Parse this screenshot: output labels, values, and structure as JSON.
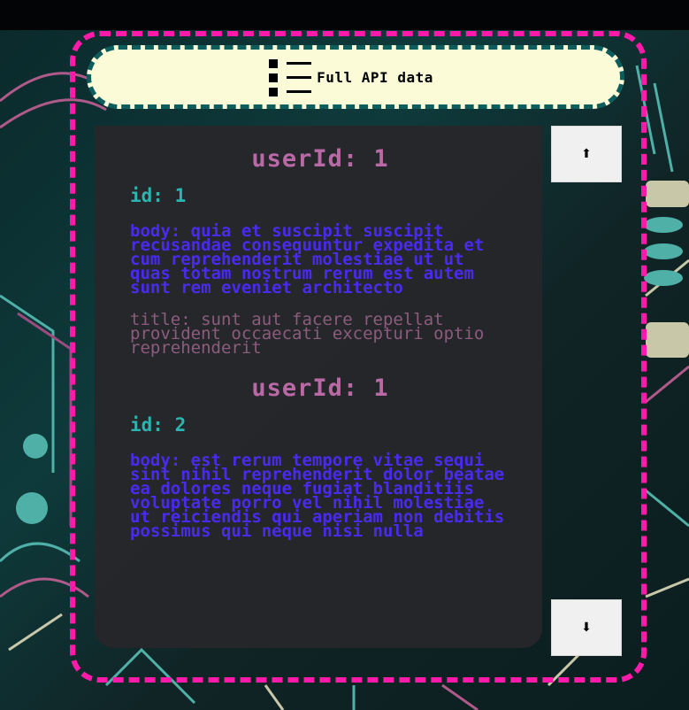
{
  "header": {
    "label": "Full API data",
    "icon": "list-icon"
  },
  "scroll": {
    "up_icon": "arrow-up-icon",
    "up_glyph": "⬆",
    "down_icon": "arrow-down-icon",
    "down_glyph": "⬇"
  },
  "posts": [
    {
      "userId": "userId: 1",
      "id": "id: 1",
      "body": "body: quia et suscipit suscipit recusandae consequuntur expedita et cum reprehenderit molestiae ut ut quas totam nostrum rerum est autem sunt rem eveniet architecto",
      "title": "title: sunt aut facere repellat provident occaecati excepturi optio reprehenderit"
    },
    {
      "userId": "userId: 1",
      "id": "id: 2",
      "body": "body: est rerum tempore vitae sequi sint nihil reprehenderit dolor beatae ea dolores neque fugiat blanditiis voluptate porro vel nihil molestiae ut reiciendis qui aperiam non debitis possimus qui neque nisi nulla",
      "title": ""
    }
  ],
  "colors": {
    "frame_border": "#ff1aaa",
    "header_bg": "#fbfbd8",
    "header_border": "#0d5d5d",
    "userid": "#b96aa6",
    "id": "#2bb5b0",
    "body": "#4b2af0",
    "title": "#8c5c7e"
  }
}
